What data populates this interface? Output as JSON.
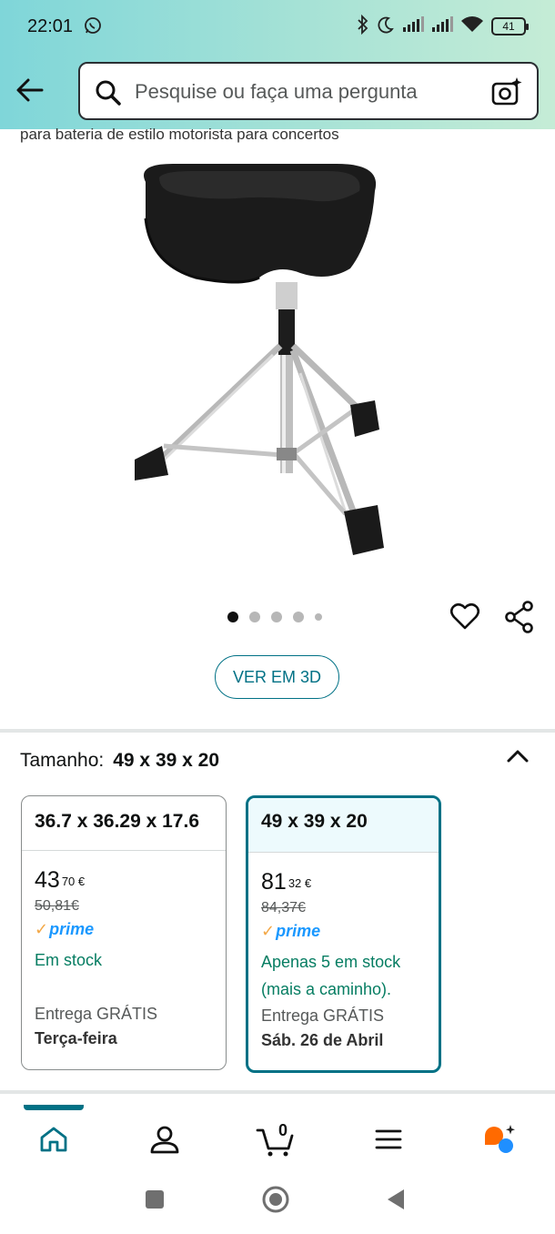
{
  "status_bar": {
    "time": "22:01",
    "battery": "41"
  },
  "search": {
    "placeholder": "Pesquise ou faça uma pergunta"
  },
  "product": {
    "subtitle": "para bateria de estilo motorista para concertos",
    "image_count": 5,
    "active_image": 1,
    "view_3d_label": "VER EM 3D"
  },
  "size_selector": {
    "label": "Tamanho:",
    "selected": "49 x 39 x 20",
    "options": [
      {
        "size": "36.7 x 36.29 x 17.6",
        "price_whole": "43",
        "price_fraction": "70",
        "currency": "€",
        "old_price": "50,81€",
        "prime": "prime",
        "stock": "Em stock",
        "stock_line2": "",
        "delivery": "Entrega GRÁTIS",
        "delivery_day": "Terça-feira"
      },
      {
        "size": "49 x 39 x 20",
        "price_whole": "81",
        "price_fraction": "32",
        "currency": "€",
        "old_price": "84,37€",
        "prime": "prime",
        "stock": "Apenas 5 em stock",
        "stock_line2": "(mais a caminho).",
        "delivery": "Entrega GRÁTIS",
        "delivery_day": "Sáb. 26 de Abril"
      }
    ]
  },
  "bottom_nav": {
    "cart_count": "0",
    "items": [
      "home-icon",
      "account-icon",
      "cart-icon",
      "menu-icon",
      "rufus-ai-icon"
    ]
  },
  "colors": {
    "accent": "#007185",
    "stock_green": "#067d62",
    "prime_blue": "#1a98ff"
  }
}
